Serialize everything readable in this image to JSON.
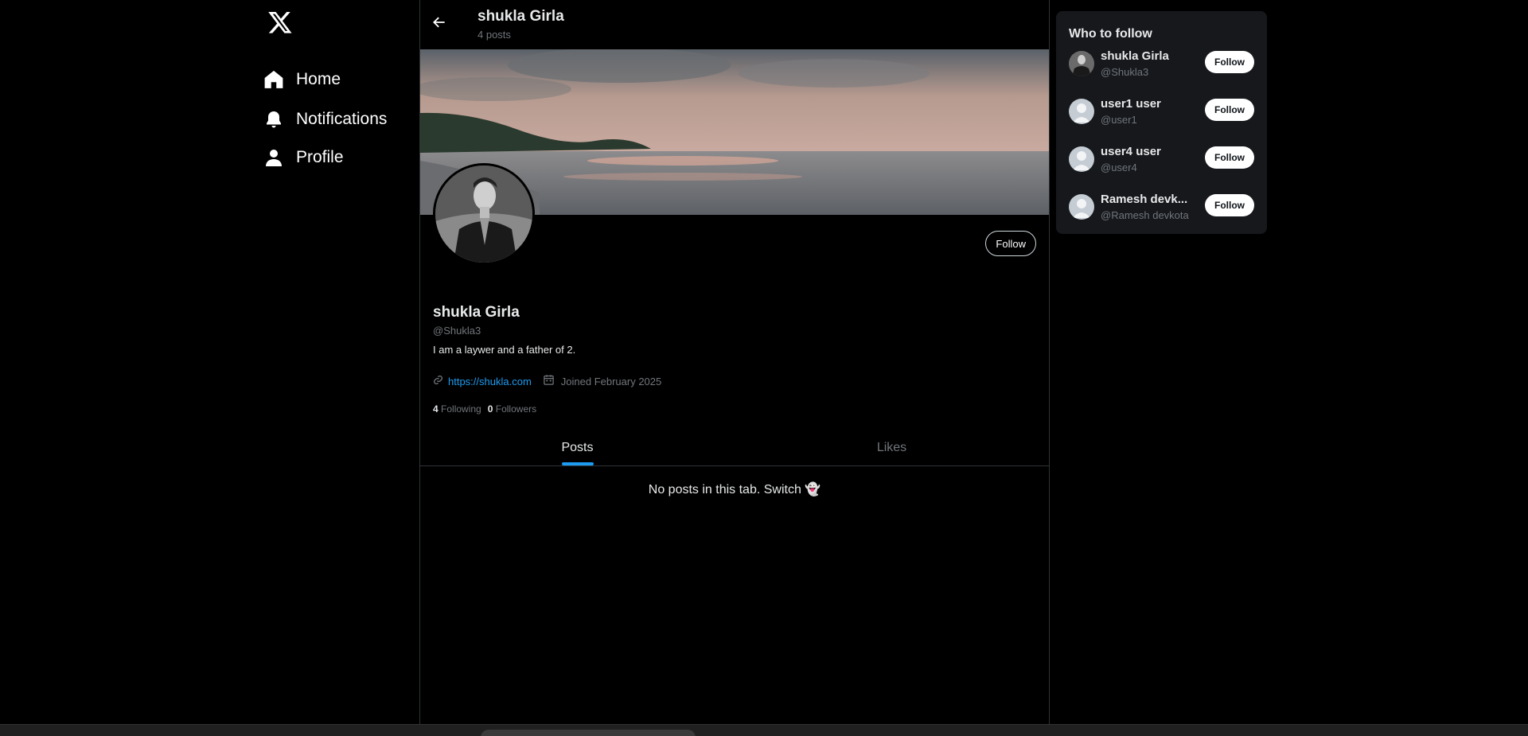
{
  "nav": {
    "home_label": "Home",
    "notifications_label": "Notifications",
    "profile_label": "Profile"
  },
  "header": {
    "name": "shukla Girla",
    "posts_count": "4 posts"
  },
  "profile": {
    "follow_label": "Follow",
    "name": "shukla Girla",
    "handle": "@Shukla3",
    "bio": "I am a laywer and a father of 2.",
    "website": "https://shukla.com",
    "joined": "Joined February 2025",
    "following_count": "4",
    "following_label": "Following",
    "followers_count": "0",
    "followers_label": "Followers"
  },
  "tabs": [
    {
      "label": "Posts",
      "active": true
    },
    {
      "label": "Likes",
      "active": false
    }
  ],
  "empty_message": "No posts in this tab. Switch 👻",
  "who_to_follow": {
    "title": "Who to follow",
    "follow_label": "Follow",
    "users": [
      {
        "name": "shukla Girla",
        "handle": "@Shukla3"
      },
      {
        "name": "user1 user",
        "handle": "@user1"
      },
      {
        "name": "user4 user",
        "handle": "@user4"
      },
      {
        "name": "Ramesh devk...",
        "handle": "@Ramesh devkota"
      }
    ]
  },
  "colors": {
    "accent": "#1d9bf0",
    "background": "#000000",
    "muted": "#71767b"
  }
}
